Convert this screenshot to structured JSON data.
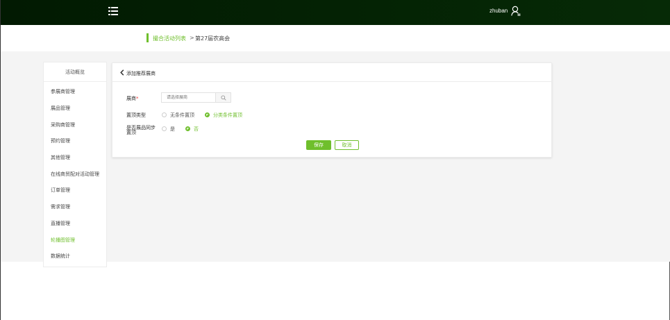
{
  "header": {
    "username": "zhuban"
  },
  "breadcrumb": {
    "parent": "撮合活动列表",
    "separator": ">",
    "current": "第27届农高会"
  },
  "sidebar": {
    "heading": "活动概览",
    "items": [
      {
        "label": "参展商管理",
        "active": false
      },
      {
        "label": "展品管理",
        "active": false
      },
      {
        "label": "采购商管理",
        "active": false
      },
      {
        "label": "预约管理",
        "active": false
      },
      {
        "label": "其他管理",
        "active": false
      },
      {
        "label": "在线商贸配对活动管理",
        "active": false
      },
      {
        "label": "订单管理",
        "active": false
      },
      {
        "label": "需求管理",
        "active": false
      },
      {
        "label": "直播管理",
        "active": false
      },
      {
        "label": "轮播图管理",
        "active": true
      },
      {
        "label": "数据统计",
        "active": false
      }
    ]
  },
  "panel": {
    "title": "添加推荐展商",
    "exhibitor": {
      "label": "展商",
      "required_mark": "*",
      "placeholder": "请选择展商"
    },
    "top_type": {
      "label": "置顶类型",
      "options": [
        {
          "label": "无条件置顶",
          "selected": false
        },
        {
          "label": "分类条件置顶",
          "selected": true
        }
      ]
    },
    "sync_top": {
      "label_line1": "是否展品同步",
      "label_line2": "置顶",
      "options": [
        {
          "label": "是",
          "selected": false
        },
        {
          "label": "否",
          "selected": true
        }
      ]
    },
    "save_label": "保存",
    "cancel_label": "取消"
  },
  "colors": {
    "accent": "#6fbf2c",
    "topbar": "#031e03",
    "background": "#f4f4f4"
  },
  "icons": {
    "menu": "list-menu-icon",
    "user": "user-icon",
    "back": "chevron-left-icon",
    "search": "search-icon"
  }
}
